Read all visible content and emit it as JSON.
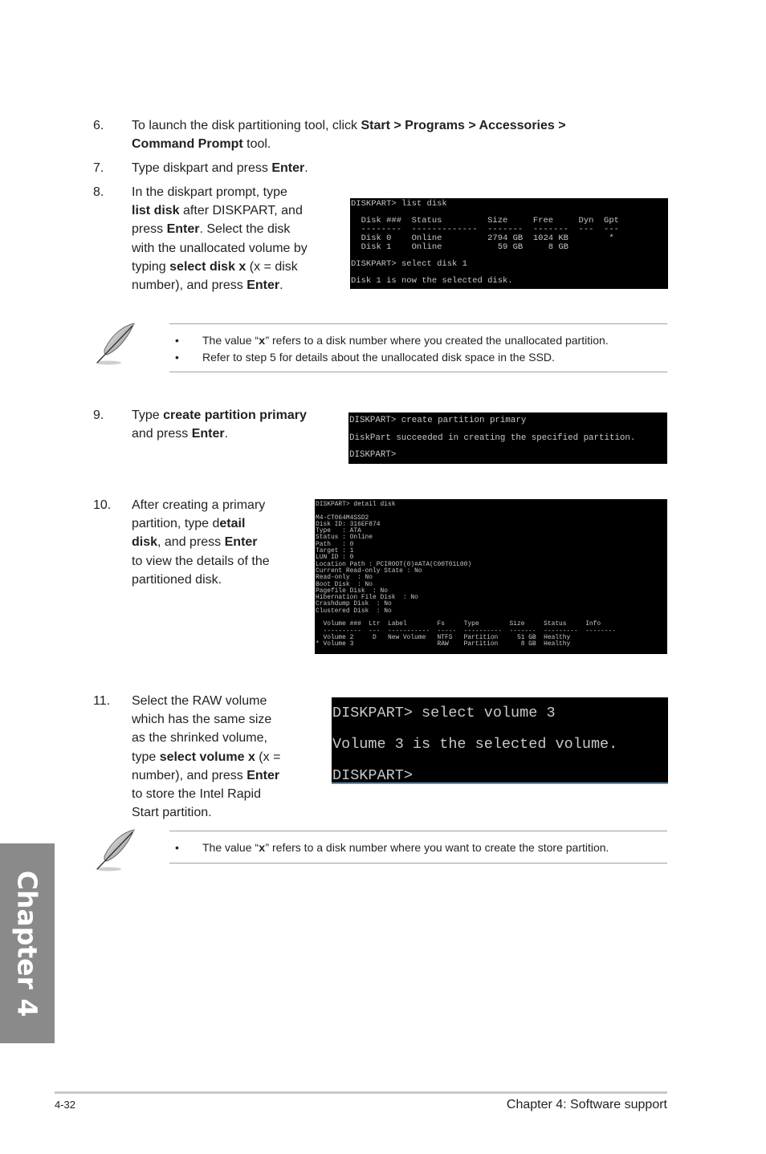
{
  "steps": {
    "s6": {
      "num": "6.",
      "parts": [
        "To launch the disk partitioning tool, click ",
        "Start > Programs > Accessories >",
        "Command Prompt",
        " tool."
      ]
    },
    "s7": {
      "num": "7.",
      "parts": [
        "Type diskpart and press ",
        "Enter",
        "."
      ]
    },
    "s8": {
      "num": "8.",
      "lines": [
        [
          "In the diskpart prompt, type",
          "",
          ""
        ],
        [
          "",
          "list disk",
          " after DISKPART, and"
        ],
        [
          "press ",
          "Enter",
          ". Select the disk"
        ],
        [
          "with the unallocated volume by",
          "",
          ""
        ],
        [
          "typing ",
          "select disk x",
          " (x = disk"
        ],
        [
          "number), and press ",
          "Enter",
          "."
        ]
      ]
    },
    "s9": {
      "num": "9.",
      "lines": [
        [
          "Type ",
          "create partition primary",
          ""
        ],
        [
          "and press ",
          "Enter",
          "."
        ]
      ]
    },
    "s10": {
      "num": "10.",
      "lines": [
        [
          "After creating a primary",
          "",
          ""
        ],
        [
          "partition, type d",
          "etail",
          ""
        ],
        [
          "",
          "disk",
          ", and press "
        ],
        [
          "",
          "",
          ""
        ],
        [
          "to view the details of the",
          "",
          ""
        ],
        [
          "partitioned disk.",
          "",
          ""
        ]
      ],
      "enter": "Enter"
    },
    "s11": {
      "num": "11.",
      "lines": [
        [
          "Select the RAW volume",
          "",
          ""
        ],
        [
          "which has the same size",
          "",
          ""
        ],
        [
          "as the shrinked volume,",
          "",
          ""
        ],
        [
          "type ",
          "select volume x",
          " (x ="
        ],
        [
          "number), and press ",
          "Enter",
          ""
        ],
        [
          "to store the Intel Rapid",
          "",
          ""
        ],
        [
          "Start partition.",
          "",
          ""
        ]
      ]
    }
  },
  "consoles": {
    "list_disk": [
      "DISKPART> list disk",
      "",
      "  Disk ###  Status         Size     Free     Dyn  Gpt",
      "  --------  -------------  -------  -------  ---  ---",
      "  Disk 0    Online         2794 GB  1024 KB        *",
      "  Disk 1    Online           59 GB     8 GB",
      "",
      "DISKPART> select disk 1",
      "",
      "Disk 1 is now the selected disk."
    ],
    "create_partition": [
      "DISKPART> create partition primary",
      "DiskPart succeeded in creating the specified partition.",
      "DISKPART>"
    ],
    "detail_disk": [
      "DISKPART> detail disk",
      "",
      "M4-CT064M4SSD2",
      "Disk ID: 316EF874",
      "Type   : ATA",
      "Status : Online",
      "Path   : 0",
      "Target : 1",
      "LUN ID : 0",
      "Location Path : PCIROOT(0)#ATA(C00T01L00)",
      "Current Read-only State : No",
      "Read-only  : No",
      "Boot Disk  : No",
      "Pagefile Disk  : No",
      "Hibernation File Disk  : No",
      "Crashdump Disk  : No",
      "Clustered Disk  : No",
      "",
      "  Volume ###  Ltr  Label        Fs     Type        Size     Status     Info",
      "  ----------  ---  -----------  -----  ----------  -------  ---------  --------",
      "  Volume 2     D   New Volume   NTFS   Partition     51 GB  Healthy",
      "* Volume 3                      RAW    Partition      8 GB  Healthy"
    ],
    "select_volume": [
      "DISKPART> select volume 3",
      "Volume 3 is the selected volume.",
      "DISKPART>"
    ]
  },
  "notes": {
    "note1": [
      {
        "bullet": "•",
        "before": "The value “",
        "code": "x",
        "after": "” refers to a disk number where you created the unallocated partition."
      },
      {
        "bullet": "•",
        "before": "Refer to step 5 for details about the unallocated disk space in the SSD.",
        "code": "",
        "after": ""
      }
    ],
    "note2": [
      {
        "bullet": "•",
        "before": "The value “",
        "code": "x",
        "after": "” refers to a disk number where you want to create the store partition."
      }
    ],
    "icon": "feather-note-icon"
  },
  "sidebar": {
    "chapter_tab": "Chapter 4"
  },
  "footer": {
    "page_number": "4-32",
    "chapter_title": "Chapter 4: Software support"
  },
  "colors": {
    "chapter_tab_bg": "#8a8a8b",
    "console_bg": "#000000",
    "console_fg": "#c8c8c8",
    "body_text": "#231f20"
  }
}
